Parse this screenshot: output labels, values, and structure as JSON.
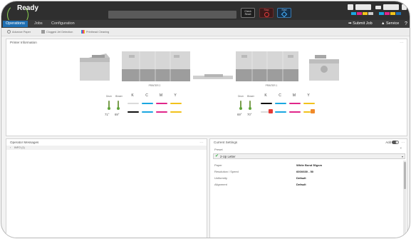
{
  "status": {
    "title": "Ready",
    "check_reset_label": "Check\nReset",
    "stop_label": "Stop",
    "start_label": "Start"
  },
  "nav": {
    "tabs": [
      {
        "label": "Operations",
        "active": true
      },
      {
        "label": "Jobs",
        "active": false
      },
      {
        "label": "Configuration",
        "active": false
      }
    ],
    "submit_job": "Submit Job",
    "service": "Service",
    "help": "?"
  },
  "toolbar": {
    "advance_paper": "Advance Paper",
    "clogged_jet": "Clogged Jet Detection",
    "printhead_cleaning": "Printhead Cleaning"
  },
  "printer_info": {
    "title": "Printer Information",
    "more": "...",
    "printers": [
      {
        "name": "PRINTER 2",
        "drum_label": "Drum",
        "blower_label": "Blower",
        "drum_temp": "71°",
        "blower_temp": "69°",
        "inks": [
          "K",
          "C",
          "M",
          "Y"
        ]
      },
      {
        "name": "PRINTER 1",
        "drum_label": "Drum",
        "blower_label": "Blower",
        "drum_temp": "69°",
        "blower_temp": "70°",
        "inks": [
          "K",
          "C",
          "M",
          "Y"
        ]
      }
    ],
    "colors": {
      "K": "#111111",
      "C": "#1aa7e0",
      "M": "#e0268a",
      "Y": "#f2c21b"
    }
  },
  "operator_messages": {
    "title": "Operator Messages",
    "more": "...",
    "row": "INFO (1)"
  },
  "current_settings": {
    "title": "Current Settings",
    "add_label": "Add",
    "more": "...",
    "preset_label": "Preset",
    "preset_value": "2-Up Letter",
    "rows": [
      {
        "label": "Paper",
        "value": "White Bond 50gsm"
      },
      {
        "label": "Resolution / Speed",
        "value": "600X600 - 50"
      },
      {
        "label": "Uniformity",
        "value": "Default"
      },
      {
        "label": "Alignment",
        "value": "Default"
      }
    ]
  }
}
